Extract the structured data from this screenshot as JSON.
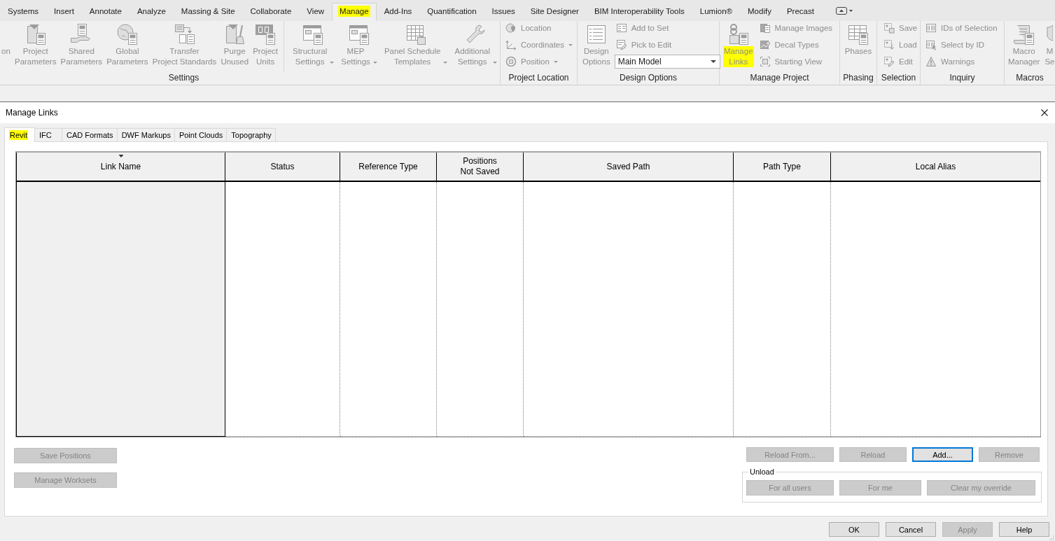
{
  "ribbon": {
    "tabs": [
      {
        "label": "Systems",
        "selected": false,
        "highlighted": false
      },
      {
        "label": "Insert",
        "selected": false,
        "highlighted": false
      },
      {
        "label": "Annotate",
        "selected": false,
        "highlighted": false
      },
      {
        "label": "Analyze",
        "selected": false,
        "highlighted": false
      },
      {
        "label": "Massing & Site",
        "selected": false,
        "highlighted": false
      },
      {
        "label": "Collaborate",
        "selected": false,
        "highlighted": false
      },
      {
        "label": "View",
        "selected": false,
        "highlighted": false
      },
      {
        "label": "Manage",
        "selected": true,
        "highlighted": true
      },
      {
        "label": "Add-Ins",
        "selected": false,
        "highlighted": false
      },
      {
        "label": "Quantification",
        "selected": false,
        "highlighted": false
      },
      {
        "label": "Issues",
        "selected": false,
        "highlighted": false
      },
      {
        "label": "Site Designer",
        "selected": false,
        "highlighted": false
      },
      {
        "label": "BIM Interoperability Tools",
        "selected": false,
        "highlighted": false
      },
      {
        "label": "Lumion®",
        "selected": false,
        "highlighted": false
      },
      {
        "label": "Modify",
        "selected": false,
        "highlighted": false
      },
      {
        "label": "Precast",
        "selected": false,
        "highlighted": false
      }
    ],
    "disabled": true,
    "panels": [
      {
        "title": "Settings",
        "groups": [
          {
            "items": [
              {
                "kind": "large",
                "label": "on",
                "dropdown": false
              },
              {
                "kind": "large",
                "label": "Project\nParameters",
                "dropdown": false
              },
              {
                "kind": "large",
                "label": "Shared\nParameters",
                "dropdown": false
              },
              {
                "kind": "large",
                "label": "Global\nParameters",
                "dropdown": false
              },
              {
                "kind": "large",
                "label": "Transfer\nProject Standards",
                "dropdown": false
              },
              {
                "kind": "large",
                "label": "Purge\nUnused",
                "dropdown": false
              },
              {
                "kind": "large",
                "label": "Project\nUnits",
                "dropdown": false
              }
            ]
          },
          {
            "items": [
              {
                "kind": "large",
                "label": "Structural\nSettings",
                "dropdown": true
              },
              {
                "kind": "large",
                "label": "MEP\nSettings",
                "dropdown": true
              },
              {
                "kind": "large",
                "label": "Panel Schedule\nTemplates",
                "dropdown": true
              },
              {
                "kind": "large",
                "label": "Additional\nSettings",
                "dropdown": true
              }
            ]
          }
        ]
      },
      {
        "title": "Project Location",
        "items": [
          {
            "kind": "small",
            "label": "Location",
            "dropdown": false
          },
          {
            "kind": "small",
            "label": "Coordinates",
            "dropdown": true
          },
          {
            "kind": "small",
            "label": "Position",
            "dropdown": true
          }
        ]
      },
      {
        "title": "Design Options",
        "items": [
          {
            "kind": "large",
            "label": "Design\nOptions",
            "dropdown": false
          },
          {
            "kind": "small",
            "label": "Add to Set",
            "dropdown": false
          },
          {
            "kind": "small",
            "label": "Pick to Edit",
            "dropdown": false
          },
          {
            "kind": "combo",
            "value": "Main Model"
          }
        ]
      },
      {
        "title": "Manage Project",
        "items": [
          {
            "kind": "large",
            "label": "Manage\nLinks",
            "dropdown": false,
            "highlighted": true
          },
          {
            "kind": "small",
            "label": "Manage Images",
            "dropdown": false,
            "highlighted": false
          },
          {
            "kind": "small",
            "label": "Decal Types",
            "dropdown": false,
            "highlighted": false
          },
          {
            "kind": "small",
            "label": "Starting View",
            "dropdown": false,
            "highlighted": false
          }
        ]
      },
      {
        "title": "Phasing",
        "items": [
          {
            "kind": "large",
            "label": "Phases",
            "dropdown": false
          }
        ]
      },
      {
        "title": "Selection",
        "items": [
          {
            "kind": "small",
            "label": "Save",
            "dropdown": false
          },
          {
            "kind": "small",
            "label": "Load",
            "dropdown": false
          },
          {
            "kind": "small",
            "label": "Edit",
            "dropdown": false
          }
        ]
      },
      {
        "title": "Inquiry",
        "items": [
          {
            "kind": "small",
            "label": "IDs of Selection",
            "dropdown": false
          },
          {
            "kind": "small",
            "label": "Select by ID",
            "dropdown": false
          },
          {
            "kind": "small",
            "label": "Warnings",
            "dropdown": false
          }
        ]
      },
      {
        "title": "Macros",
        "items": [
          {
            "kind": "large",
            "label": "Macro\nManager",
            "dropdown": false
          },
          {
            "kind": "large",
            "label": "M\nSe",
            "dropdown": false
          }
        ]
      }
    ]
  },
  "dialog": {
    "title": "Manage Links",
    "tabs": [
      {
        "label": "Revit",
        "selected": true,
        "highlighted": true
      },
      {
        "label": "IFC",
        "selected": false,
        "highlighted": false
      },
      {
        "label": "CAD Formats",
        "selected": false,
        "highlighted": false
      },
      {
        "label": "DWF Markups",
        "selected": false,
        "highlighted": false
      },
      {
        "label": "Point Clouds",
        "selected": false,
        "highlighted": false
      },
      {
        "label": "Topography",
        "selected": false,
        "highlighted": false
      }
    ],
    "table": {
      "columns": [
        {
          "label": "Link Name",
          "sorted": true
        },
        {
          "label": "Status",
          "sorted": false
        },
        {
          "label": "Reference Type",
          "sorted": false
        },
        {
          "label": "Positions\nNot Saved",
          "sorted": false
        },
        {
          "label": "Saved Path",
          "sorted": false
        },
        {
          "label": "Path Type",
          "sorted": false
        },
        {
          "label": "Local Alias",
          "sorted": false
        }
      ]
    },
    "left_buttons": [
      {
        "label": "Save Positions",
        "disabled": true
      },
      {
        "label": "Manage Worksets",
        "disabled": true
      }
    ],
    "link_buttons": [
      {
        "label": "Reload From...",
        "disabled": true,
        "focused": false
      },
      {
        "label": "Reload",
        "disabled": true,
        "focused": false
      },
      {
        "label": "Add...",
        "disabled": false,
        "focused": true
      },
      {
        "label": "Remove",
        "disabled": true,
        "focused": false
      }
    ],
    "unload": {
      "title": "Unload",
      "buttons": [
        {
          "label": "For all users",
          "disabled": true
        },
        {
          "label": "For me",
          "disabled": true
        },
        {
          "label": "Clear my override",
          "disabled": true
        }
      ]
    },
    "footer_buttons": [
      {
        "label": "OK",
        "disabled": false
      },
      {
        "label": "Cancel",
        "disabled": false
      },
      {
        "label": "Apply",
        "disabled": true
      },
      {
        "label": "Help",
        "disabled": false
      }
    ]
  }
}
